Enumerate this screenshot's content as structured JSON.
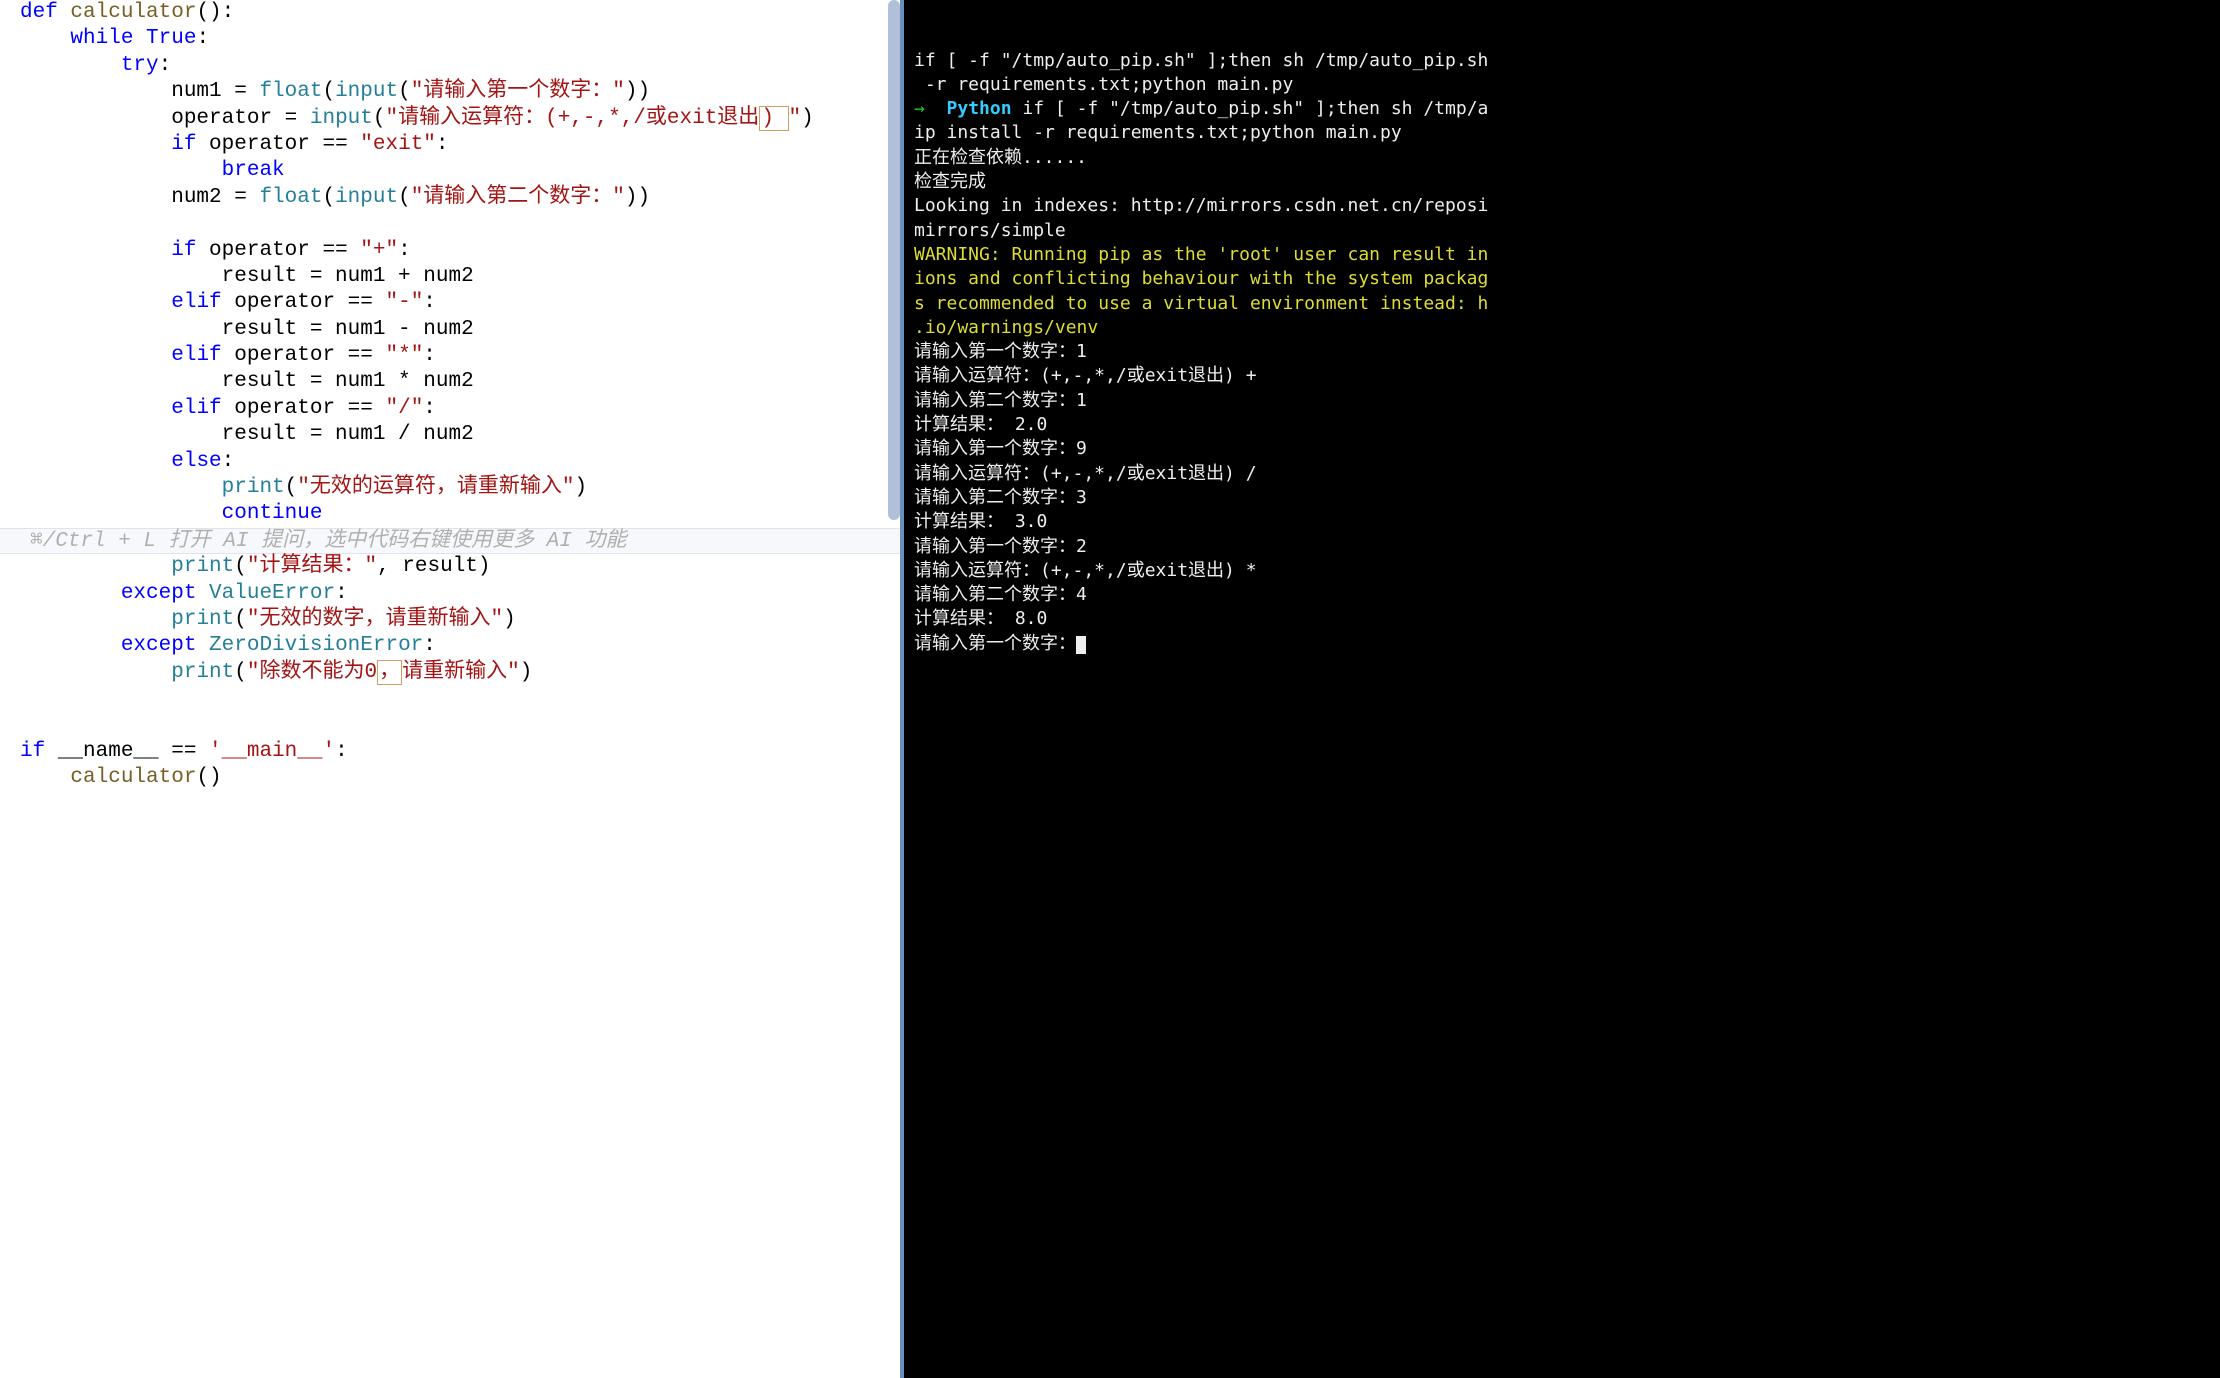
{
  "editor": {
    "tokens": [
      [
        [
          "kw",
          "def "
        ],
        [
          "fn",
          "calculator"
        ],
        [
          "punc",
          "():"
        ]
      ],
      [
        [
          "",
          "    "
        ],
        [
          "kw",
          "while "
        ],
        [
          "boolc",
          "True"
        ],
        [
          "punc",
          ":"
        ]
      ],
      [
        [
          "",
          "        "
        ],
        [
          "kw",
          "try"
        ],
        [
          "punc",
          ":"
        ]
      ],
      [
        [
          "",
          "            num1 = "
        ],
        [
          "call",
          "float"
        ],
        [
          "punc",
          "("
        ],
        [
          "call",
          "input"
        ],
        [
          "punc",
          "("
        ],
        [
          "str",
          "\"请输入第一个数字：\""
        ],
        [
          "punc",
          "))"
        ]
      ],
      [
        [
          "",
          "            operator = "
        ],
        [
          "call",
          "input"
        ],
        [
          "punc",
          "("
        ],
        [
          "str",
          "\"请输入运算符：(+,-,*,/或exit退出"
        ],
        [
          "mbox str",
          ") "
        ],
        [
          "str",
          "\""
        ],
        [
          "punc",
          ")"
        ]
      ],
      [
        [
          "",
          "            "
        ],
        [
          "kw",
          "if"
        ],
        [
          "",
          " operator == "
        ],
        [
          "str",
          "\"exit\""
        ],
        [
          "punc",
          ":"
        ]
      ],
      [
        [
          "",
          "                "
        ],
        [
          "kw2",
          "break"
        ]
      ],
      [
        [
          "",
          "            num2 = "
        ],
        [
          "call",
          "float"
        ],
        [
          "punc",
          "("
        ],
        [
          "call",
          "input"
        ],
        [
          "punc",
          "("
        ],
        [
          "str",
          "\"请输入第二个数字：\""
        ],
        [
          "punc",
          "))"
        ]
      ],
      [
        [
          "",
          ""
        ]
      ],
      [
        [
          "",
          "            "
        ],
        [
          "kw",
          "if"
        ],
        [
          "",
          " operator == "
        ],
        [
          "str",
          "\"+\""
        ],
        [
          "punc",
          ":"
        ]
      ],
      [
        [
          "",
          "                result = num1 + num2"
        ]
      ],
      [
        [
          "",
          "            "
        ],
        [
          "kw",
          "elif"
        ],
        [
          "",
          " operator == "
        ],
        [
          "str",
          "\"-\""
        ],
        [
          "punc",
          ":"
        ]
      ],
      [
        [
          "",
          "                result = num1 - num2"
        ]
      ],
      [
        [
          "",
          "            "
        ],
        [
          "kw",
          "elif"
        ],
        [
          "",
          " operator == "
        ],
        [
          "str",
          "\"*\""
        ],
        [
          "punc",
          ":"
        ]
      ],
      [
        [
          "",
          "                result = num1 * num2"
        ]
      ],
      [
        [
          "",
          "            "
        ],
        [
          "kw",
          "elif"
        ],
        [
          "",
          " operator == "
        ],
        [
          "str",
          "\"/\""
        ],
        [
          "punc",
          ":"
        ]
      ],
      [
        [
          "",
          "                result = num1 / num2"
        ]
      ],
      [
        [
          "",
          "            "
        ],
        [
          "kw",
          "else"
        ],
        [
          "punc",
          ":"
        ]
      ],
      [
        [
          "",
          "                "
        ],
        [
          "call",
          "print"
        ],
        [
          "punc",
          "("
        ],
        [
          "str",
          "\"无效的运算符，请重新输入\""
        ],
        [
          "punc",
          ")"
        ]
      ],
      [
        [
          "",
          "                "
        ],
        [
          "kw2",
          "continue"
        ]
      ],
      "HINT",
      [
        [
          "",
          "            "
        ],
        [
          "call",
          "print"
        ],
        [
          "punc",
          "("
        ],
        [
          "str",
          "\"计算结果：\""
        ],
        [
          "punc",
          ", result)"
        ]
      ],
      [
        [
          "",
          "        "
        ],
        [
          "kw",
          "except "
        ],
        [
          "cls",
          "ValueError"
        ],
        [
          "punc",
          ":"
        ]
      ],
      [
        [
          "",
          "            "
        ],
        [
          "call",
          "print"
        ],
        [
          "punc",
          "("
        ],
        [
          "str",
          "\"无效的数字，请重新输入\""
        ],
        [
          "punc",
          ")"
        ]
      ],
      [
        [
          "",
          "        "
        ],
        [
          "kw",
          "except "
        ],
        [
          "cls",
          "ZeroDivisionError"
        ],
        [
          "punc",
          ":"
        ]
      ],
      [
        [
          "",
          "            "
        ],
        [
          "call",
          "print"
        ],
        [
          "punc",
          "("
        ],
        [
          "str",
          "\"除数不能为0"
        ],
        [
          "mbox str",
          "，"
        ],
        [
          "str",
          "请重新输入\""
        ],
        [
          "punc",
          ")"
        ]
      ],
      [
        [
          "",
          ""
        ]
      ],
      [
        [
          "",
          ""
        ]
      ],
      [
        [
          "kw",
          "if"
        ],
        [
          "",
          " __name__ == "
        ],
        [
          "str",
          "'__main__'"
        ],
        [
          "punc",
          ":"
        ]
      ],
      [
        [
          "",
          "    "
        ],
        [
          "fn",
          "calculator"
        ],
        [
          "punc",
          "()"
        ]
      ]
    ],
    "hint": "⌘/Ctrl + L 打开 AI 提问，选中代码右键使用更多 AI 功能"
  },
  "terminal": {
    "lines": [
      [
        [
          "term-white",
          "if [ -f \"/tmp/auto_pip.sh\" ];then sh /tmp/auto_pip.sh"
        ]
      ],
      [
        [
          "term-white",
          " -r requirements.txt;python main.py"
        ]
      ],
      [
        [
          "term-green",
          "→  "
        ],
        [
          "term-cyan",
          "Python"
        ],
        [
          "term-white",
          " if [ -f \"/tmp/auto_pip.sh\" ];then sh /tmp/a"
        ]
      ],
      [
        [
          "term-white",
          "ip install -r requirements.txt;python main.py"
        ]
      ],
      [
        [
          "term-white",
          "正在检查依赖......"
        ]
      ],
      [
        [
          "term-white",
          "检查完成"
        ]
      ],
      [
        [
          "term-white",
          "Looking in indexes: http://mirrors.csdn.net.cn/reposi"
        ]
      ],
      [
        [
          "term-white",
          "mirrors/simple"
        ]
      ],
      [
        [
          "term-yellow",
          "WARNING: Running pip as the 'root' user can result in"
        ]
      ],
      [
        [
          "term-yellow",
          "ions and conflicting behaviour with the system packag"
        ]
      ],
      [
        [
          "term-yellow",
          "s recommended to use a virtual environment instead: h"
        ]
      ],
      [
        [
          "term-yellow",
          ".io/warnings/venv"
        ]
      ],
      [
        [
          "term-white",
          "请输入第一个数字：1"
        ]
      ],
      [
        [
          "term-white",
          "请输入运算符：(+,-,*,/或exit退出) +"
        ]
      ],
      [
        [
          "term-white",
          "请输入第二个数字：1"
        ]
      ],
      [
        [
          "term-white",
          "计算结果： 2.0"
        ]
      ],
      [
        [
          "term-white",
          "请输入第一个数字：9"
        ]
      ],
      [
        [
          "term-white",
          "请输入运算符：(+,-,*,/或exit退出) /"
        ]
      ],
      [
        [
          "term-white",
          "请输入第二个数字：3"
        ]
      ],
      [
        [
          "term-white",
          "计算结果： 3.0"
        ]
      ],
      [
        [
          "term-white",
          "请输入第一个数字：2"
        ]
      ],
      [
        [
          "term-white",
          "请输入运算符：(+,-,*,/或exit退出) *"
        ]
      ],
      [
        [
          "term-white",
          "请输入第二个数字：4"
        ]
      ],
      [
        [
          "term-white",
          "计算结果： 8.0"
        ]
      ],
      [
        [
          "term-white",
          "请输入第一个数字："
        ],
        [
          "cursor",
          ""
        ]
      ]
    ]
  }
}
